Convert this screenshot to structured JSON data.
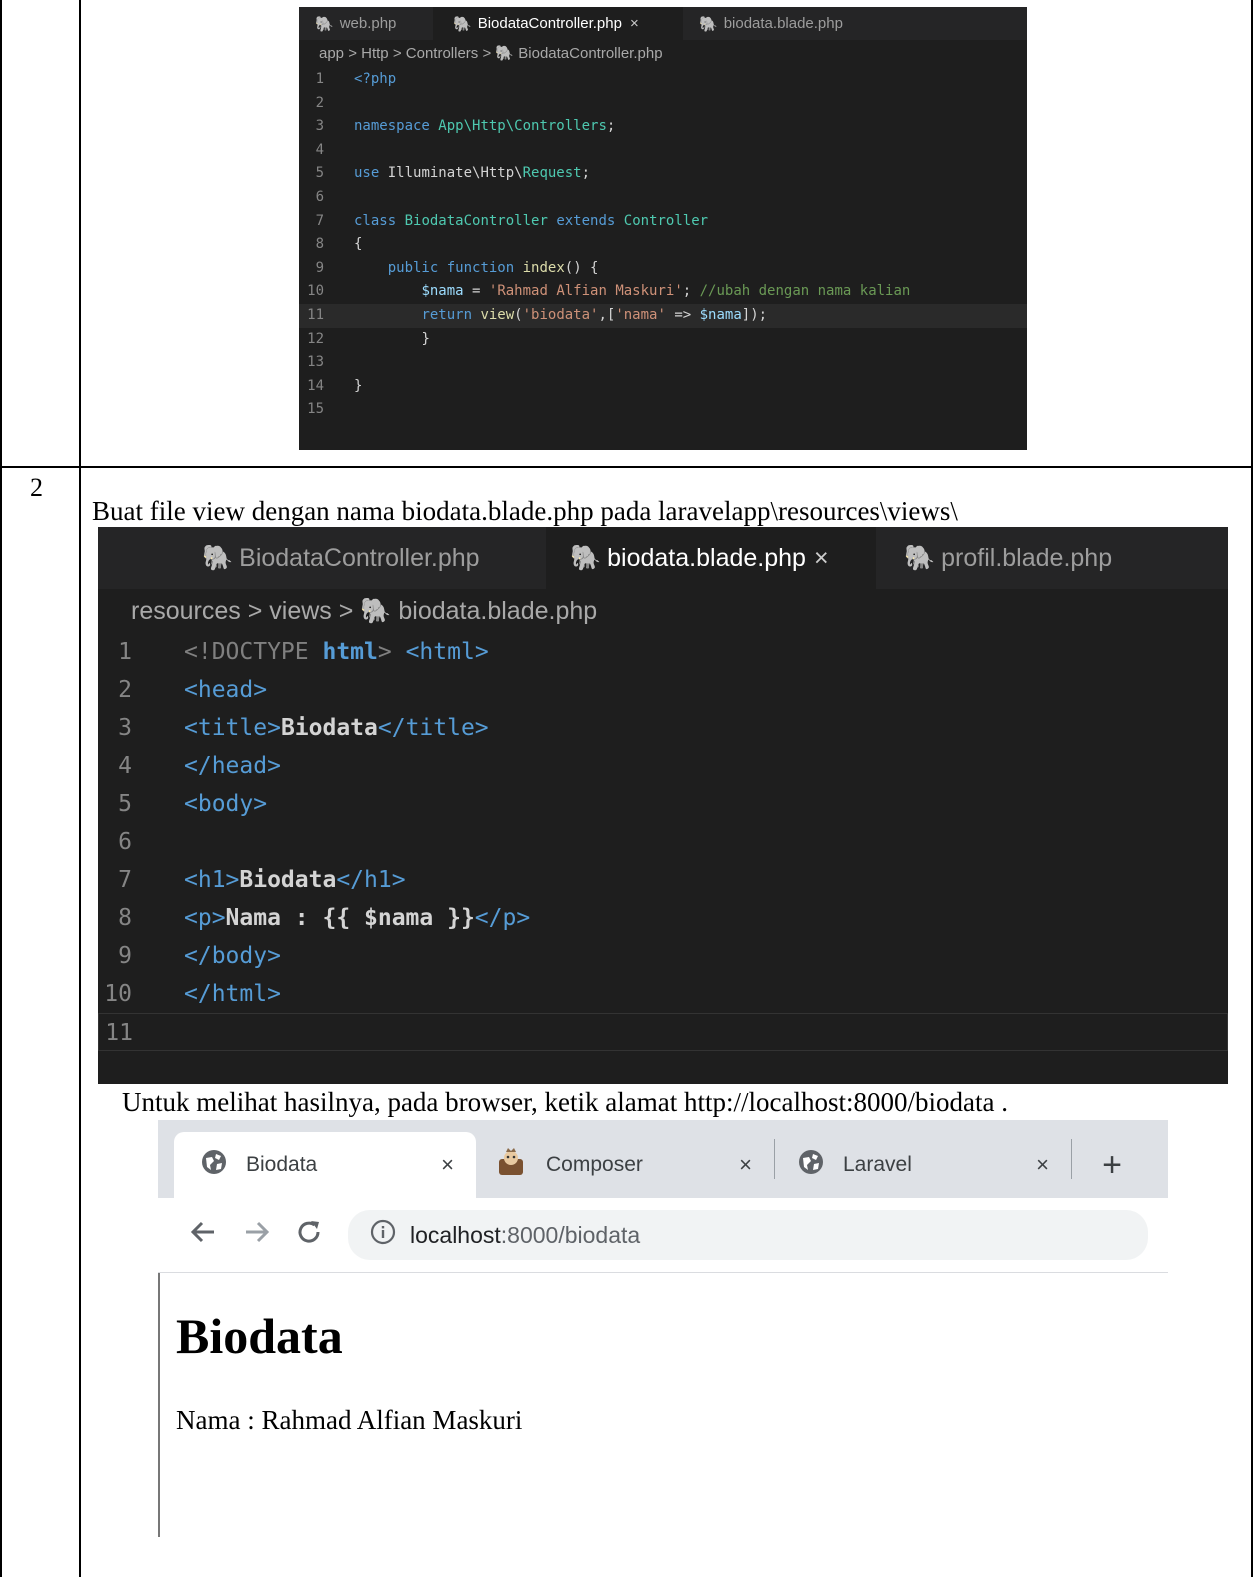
{
  "table": {
    "row2_number": "2"
  },
  "editor1": {
    "tabs": [
      {
        "label": "web.php",
        "active": false
      },
      {
        "label": "BiodataController.php",
        "active": true,
        "close": "×"
      },
      {
        "label": "biodata.blade.php",
        "active": false
      }
    ],
    "breadcrumb": {
      "part1": "app",
      "part2": "Http",
      "part3": "Controllers",
      "file": "BiodataController.php"
    },
    "line_numbers": [
      "1",
      "2",
      "3",
      "4",
      "5",
      "6",
      "7",
      "8",
      "9",
      "10",
      "11",
      "12",
      "13",
      "14",
      "15"
    ],
    "code": {
      "l1": "<?php",
      "l3_kw": "namespace",
      "l3_ns": "App\\Http\\Controllers",
      "l5_kw": "use",
      "l5_ns": "Illuminate\\Http\\",
      "l5_cls": "Request",
      "l7_kw": "class",
      "l7_name": "BiodataController",
      "l7_ext": "extends",
      "l7_parent": "Controller",
      "l8": "{",
      "l9_kw1": "public",
      "l9_kw2": "function",
      "l9_fn": "index",
      "l9_rest": "() {",
      "l10_var": "$nama",
      "l10_eq": " = ",
      "l10_str": "'Rahmad Alfian Maskuri'",
      "l10_semi": "; ",
      "l10_cm": "//ubah dengan nama kalian",
      "l11_kw": "return",
      "l11_fn": "view",
      "l11_p1": "(",
      "l11_s1": "'biodata'",
      "l11_p2": ",[",
      "l11_s2": "'nama'",
      "l11_arrow": " => ",
      "l11_var": "$nama",
      "l11_end": "]);",
      "l12": "}",
      "l14": "}"
    }
  },
  "instruction_text": "Buat file view dengan nama biodata.blade.php pada laravelapp\\resources\\views\\",
  "editor2": {
    "tabs": [
      {
        "label": "BiodataController.php",
        "active": false
      },
      {
        "label": "biodata.blade.php",
        "active": true,
        "close": "×"
      },
      {
        "label": "profil.blade.php",
        "active": false
      }
    ],
    "breadcrumb": {
      "part1": "resources",
      "part2": "views",
      "file": "biodata.blade.php"
    },
    "line_numbers": [
      "1",
      "2",
      "3",
      "4",
      "5",
      "6",
      "7",
      "8",
      "9",
      "10",
      "11"
    ],
    "code": {
      "l1a": "<!DOCTYPE ",
      "l1b": "html",
      "l1c": "> ",
      "l1d": "<html>",
      "l2": "<head>",
      "l3a": "<title>",
      "l3b": "Biodata",
      "l3c": "</title>",
      "l4": "</head>",
      "l5": "<body>",
      "l7a": "<h1>",
      "l7b": "Biodata",
      "l7c": "</h1>",
      "l8a": "<p>",
      "l8b": "Nama : {{ $nama }}",
      "l8c": "</p>",
      "l9": "</body>",
      "l10": "</html>"
    }
  },
  "result_text": "Untuk melihat hasilnya, pada browser, ketik alamat http://localhost:8000/biodata .",
  "browser": {
    "tabs": [
      {
        "label": "Biodata",
        "close": "×",
        "icon": "globe-icon"
      },
      {
        "label": "Composer",
        "close": "×",
        "icon": "composer-icon"
      },
      {
        "label": "Laravel",
        "close": "×",
        "icon": "globe-icon"
      }
    ],
    "new_tab": "+",
    "url_host": "localhost",
    "url_rest": ":8000/biodata",
    "page_heading": "Biodata",
    "page_paragraph": "Nama : Rahmad Alfian Maskuri"
  }
}
